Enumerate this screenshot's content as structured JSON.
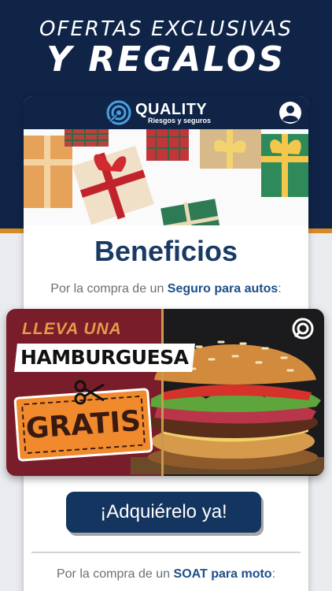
{
  "hero": {
    "line1": "OFERTAS EXCLUSIVAS",
    "line2": "Y REGALOS"
  },
  "appbar": {
    "brand_name": "QUALITY",
    "brand_sub": "Riesgos y seguros",
    "profile_icon": "user-circle-icon"
  },
  "main": {
    "heading": "Beneficios",
    "promo1_prefix": "Por la compra de un ",
    "promo1_highlight": "Seguro para autos",
    "promo1_suffix": ":",
    "banner": {
      "line1": "LLEVA UNA",
      "line2": "HAMBURGUESA",
      "line3": "GRATIS"
    },
    "cta_label": "¡Adquiérelo ya!",
    "promo2_prefix": "Por la compra de un ",
    "promo2_highlight": "SOAT para moto",
    "promo2_suffix": ":"
  },
  "colors": {
    "navy": "#0f2447",
    "accent_orange": "#d98a25",
    "heading_blue": "#1a3a66",
    "link_blue": "#1d4f8a"
  }
}
